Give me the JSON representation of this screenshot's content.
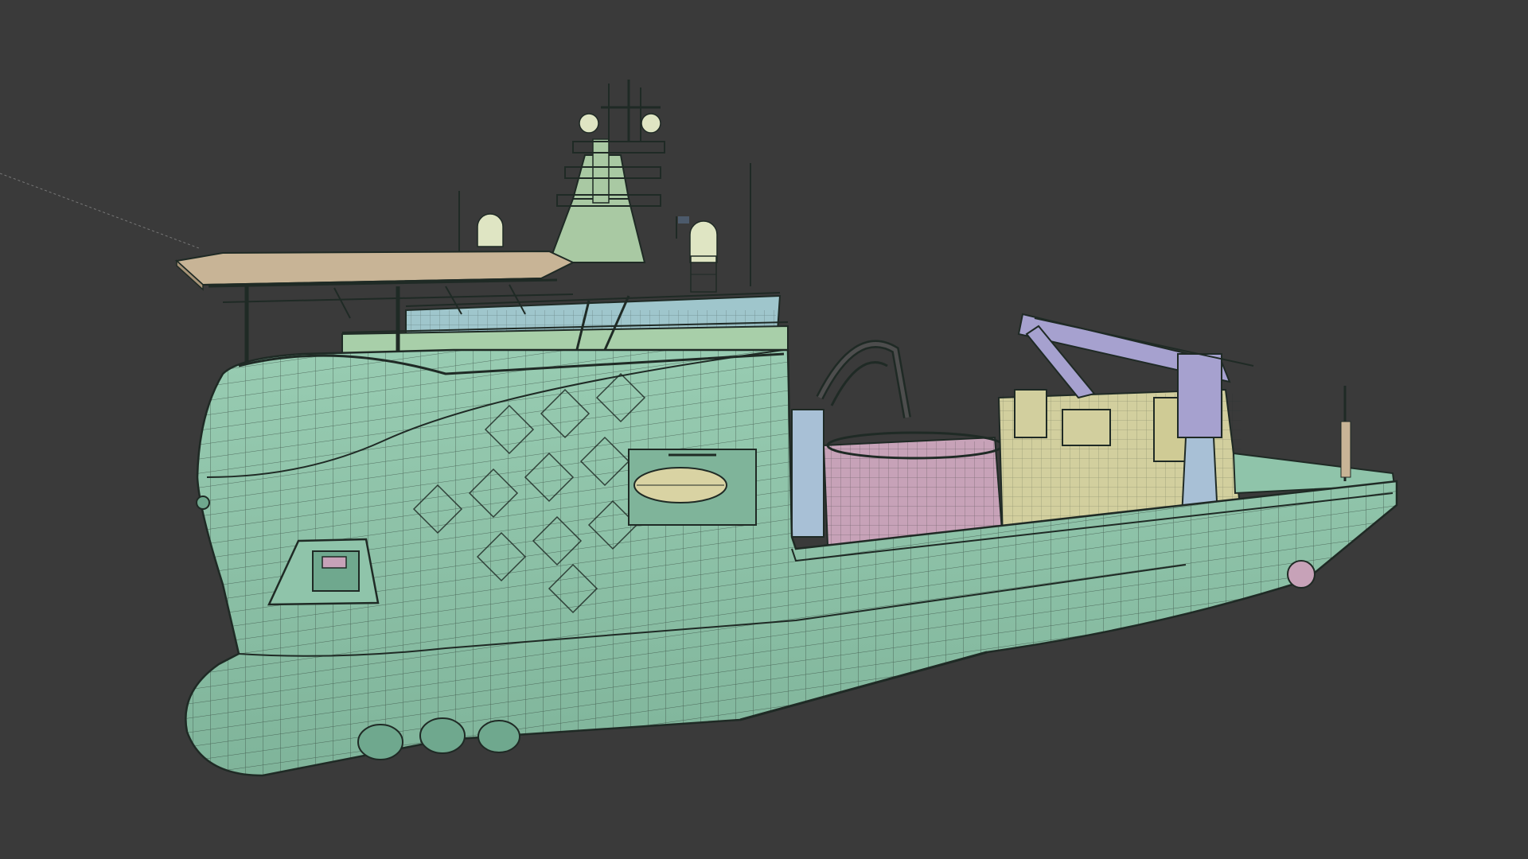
{
  "viewport": {
    "background_color": "#3a3a3a",
    "shading_mode": "shaded-with-wireframe"
  },
  "model": {
    "subject": "ship",
    "colors": {
      "hull": "#8fc4aa",
      "hull_dark": "#6fa88e",
      "wire": "#1f2a25",
      "helideck": "#c8b496",
      "superstructure_glass": "#9fc6cc",
      "carousel": "#c7a2b8",
      "crane": "#a6a1cf",
      "deck_equipment": "#d2cf9e",
      "mast": "#a9c9a3",
      "radome": "#dfe5c3",
      "lifeboat": "#d9d3a3",
      "tank": "#a8c0d6"
    }
  }
}
